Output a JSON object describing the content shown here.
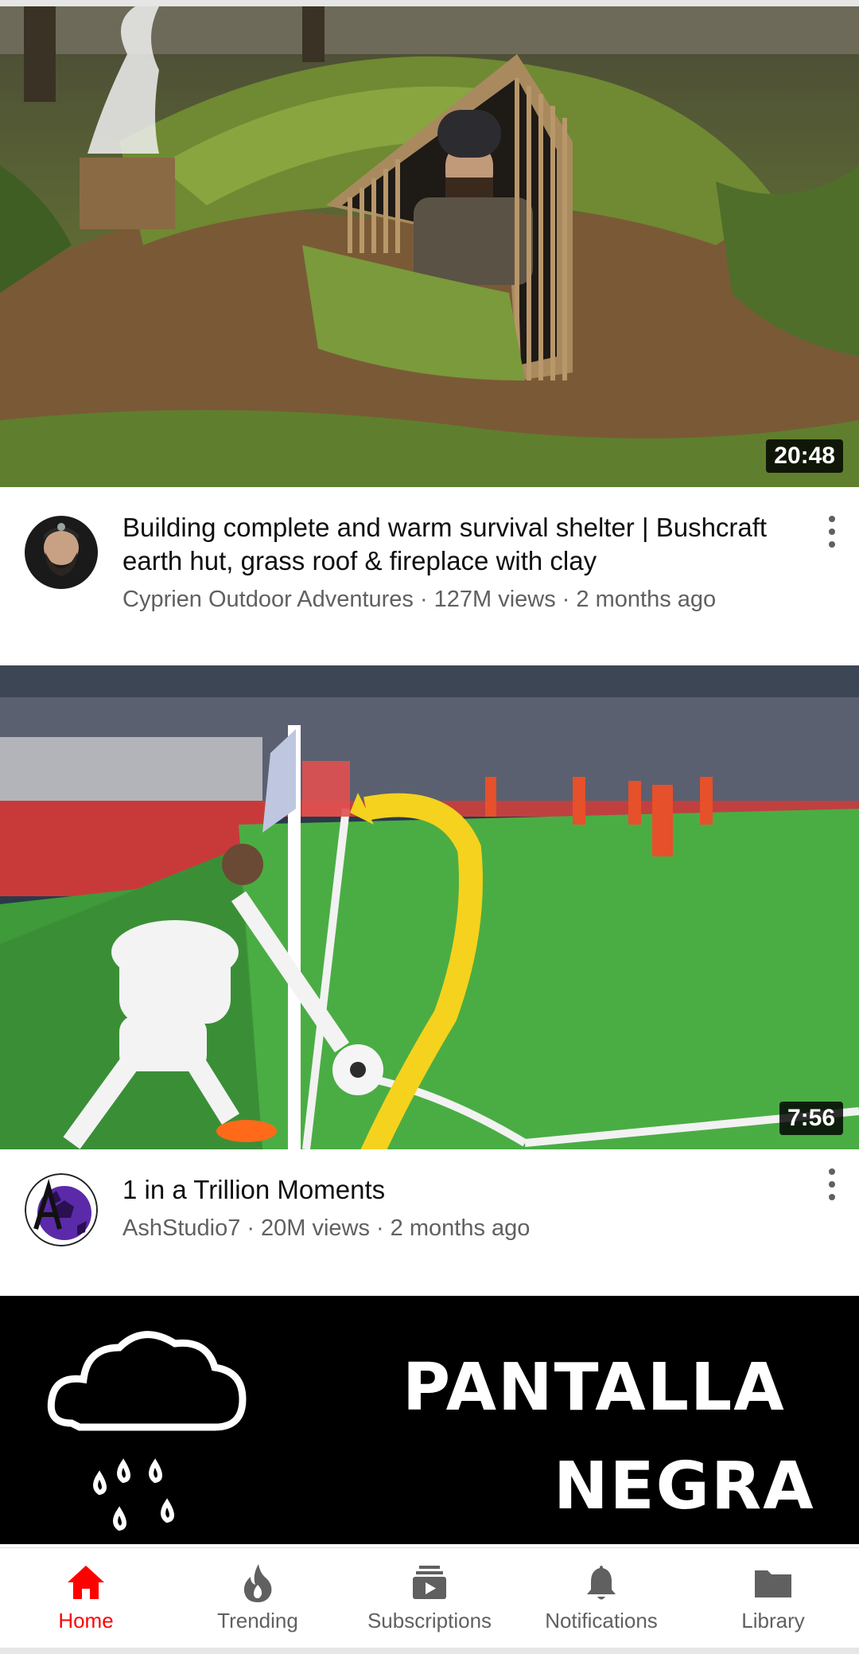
{
  "feed": {
    "videos": [
      {
        "title": "Building complete and warm survival shelter | Bushcraft earth hut, grass roof & fireplace with clay",
        "channel": "Cyprien Outdoor Adventures",
        "views": "127M views",
        "age": "2 months ago",
        "duration": "20:48",
        "avatar_icon": "bearded-man-avatar",
        "thumbnail": "forest-earth-hut"
      },
      {
        "title": "1 in a Trillion Moments",
        "channel": "AshStudio7",
        "views": "20M views",
        "age": "2 months ago",
        "duration": "7:56",
        "avatar_icon": "soccer-ball-avatar",
        "thumbnail": "football-corner-kick"
      },
      {
        "thumbnail": "black-screen-rain-cloud",
        "thumbnail_text": [
          "PANTALLA",
          "NEGRA"
        ]
      }
    ],
    "separator": "·"
  },
  "bottom_nav": {
    "items": [
      {
        "label": "Home",
        "icon": "home-icon",
        "active": true
      },
      {
        "label": "Trending",
        "icon": "flame-icon",
        "active": false
      },
      {
        "label": "Subscriptions",
        "icon": "subscriptions-icon",
        "active": false
      },
      {
        "label": "Notifications",
        "icon": "bell-icon",
        "active": false
      },
      {
        "label": "Library",
        "icon": "folder-icon",
        "active": false
      }
    ]
  },
  "colors": {
    "accent": "#ff0000",
    "secondary_text": "#606060",
    "icon_gray": "#606060"
  }
}
